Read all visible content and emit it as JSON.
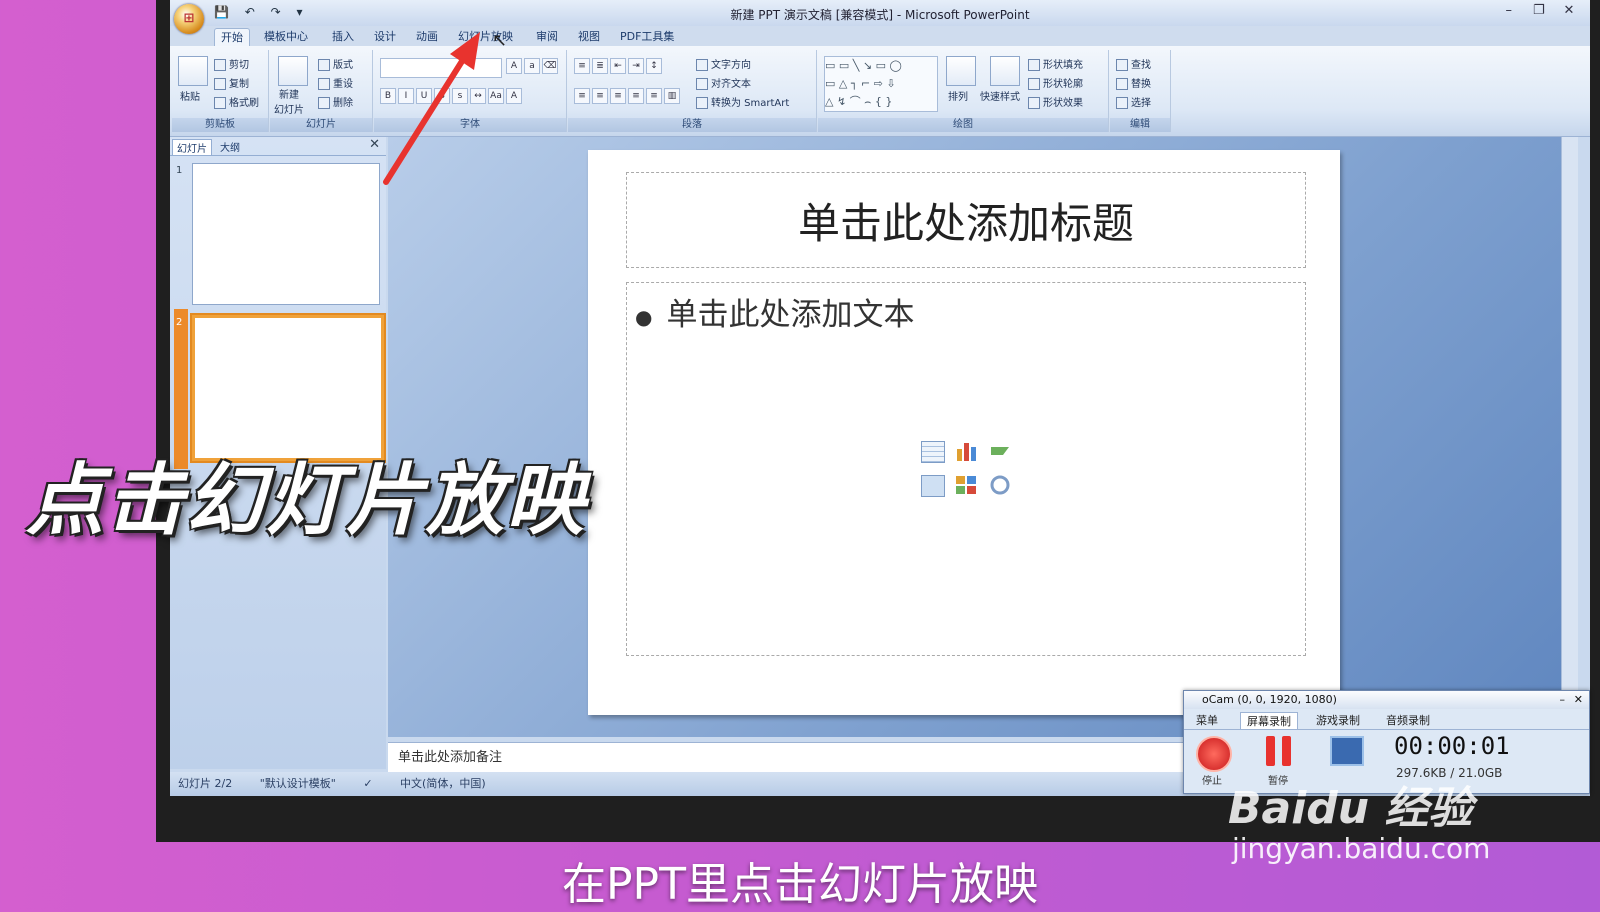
{
  "window": {
    "title": "新建 PPT 演示文稿 [兼容模式] - Microsoft PowerPoint",
    "controls": [
      "–",
      "❐",
      "✕"
    ]
  },
  "tabs": [
    "开始",
    "模板中心",
    "插入",
    "设计",
    "动画",
    "幻灯片放映",
    "审阅",
    "视图",
    "PDF工具集"
  ],
  "ribbon": {
    "clipboard": {
      "paste": "粘贴",
      "cut": "剪切",
      "copy": "复制",
      "format_painter": "格式刷",
      "label": "剪贴板"
    },
    "slides": {
      "new_slide": "新建\n幻灯片",
      "layout": "版式",
      "reset": "重设",
      "delete": "删除",
      "label": "幻灯片"
    },
    "font": {
      "label": "字体"
    },
    "paragraph": {
      "text_direction": "文字方向",
      "align_text": "对齐文本",
      "convert_smartart": "转换为 SmartArt",
      "label": "段落"
    },
    "drawing": {
      "arrange": "排列",
      "quick_styles": "快速样式",
      "shape_fill": "形状填充",
      "shape_outline": "形状轮廓",
      "shape_effects": "形状效果",
      "label": "绘图"
    },
    "editing": {
      "find": "查找",
      "replace": "替换",
      "select": "选择",
      "label": "编辑"
    }
  },
  "left_pane": {
    "tabs": [
      "幻灯片",
      "大纲"
    ],
    "close": "✕",
    "slide_numbers": [
      "1",
      "2"
    ]
  },
  "slide": {
    "title_placeholder": "单击此处添加标题",
    "body_placeholder": "单击此处添加文本"
  },
  "notes_placeholder": "单击此处添加备注",
  "status": {
    "slide_count": "幻灯片 2/2",
    "theme": "\"默认设计模板\"",
    "language": "中文(简体，中国)"
  },
  "overlay": {
    "big_caption": "点击幻灯片放映",
    "subtitle": "在PPT里点击幻灯片放映"
  },
  "ocam": {
    "title": "oCam (0, 0, 1920, 1080)",
    "tabs": [
      "菜单",
      "屏幕录制",
      "游戏录制",
      "音频录制"
    ],
    "stop_label": "停止",
    "pause_label": "暂停",
    "timer": "00:00:01",
    "size": "297.6KB / 21.0GB"
  },
  "watermark": {
    "brand": "Baidu 经验",
    "url": "jingyan.baidu.com"
  },
  "colors": {
    "background": "#c65bd0",
    "annotation_arrow": "#e8332e",
    "selected_slide": "#ec8a2a"
  }
}
